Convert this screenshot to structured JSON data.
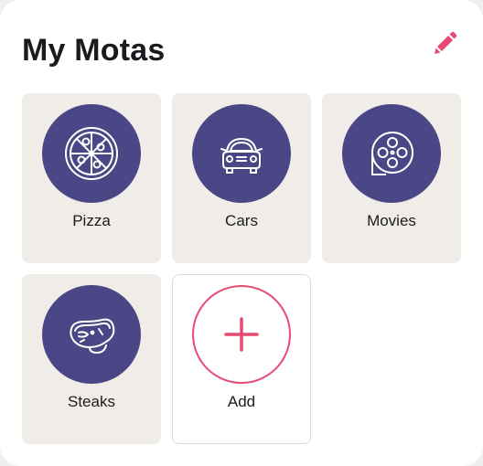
{
  "header": {
    "title": "My Motas",
    "edit_icon": "pencil-icon"
  },
  "colors": {
    "accent": "#e64b73",
    "tile_icon_bg": "#4b4685",
    "tile_bg": "#f0ede8"
  },
  "tiles": [
    {
      "label": "Pizza",
      "icon": "pizza-icon"
    },
    {
      "label": "Cars",
      "icon": "car-icon"
    },
    {
      "label": "Movies",
      "icon": "film-reel-icon"
    },
    {
      "label": "Steaks",
      "icon": "steak-icon"
    },
    {
      "label": "Add",
      "icon": "plus-icon"
    }
  ]
}
